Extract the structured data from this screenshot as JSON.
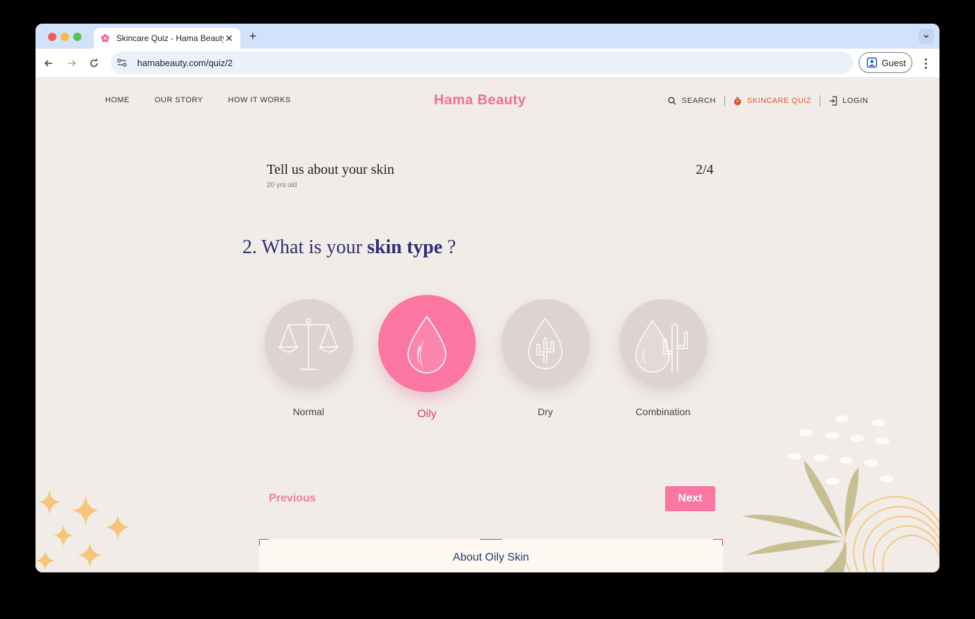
{
  "browser": {
    "tab_title": "Skincare Quiz - Hama Beauty",
    "url": "hamabeauty.com/quiz/2",
    "profile_label": "Guest"
  },
  "site": {
    "brand": "Hama Beauty",
    "nav_left": [
      "HOME",
      "OUR STORY",
      "HOW IT WORKS"
    ],
    "nav_right": {
      "search": "SEARCH",
      "quiz": "SKINCARE QUIZ",
      "login": "LOGIN"
    }
  },
  "quiz": {
    "header_title": "Tell us about your skin",
    "header_subtitle": "20 yrs old",
    "step": "2/4",
    "question_number": "2.",
    "question_prefix": "What is your",
    "question_emphasis": "skin type",
    "question_suffix": "?",
    "options": [
      {
        "label": "Normal",
        "icon": "scale-icon",
        "selected": false
      },
      {
        "label": "Oily",
        "icon": "oil-drop-icon",
        "selected": true
      },
      {
        "label": "Dry",
        "icon": "dry-drop-cactus-icon",
        "selected": false
      },
      {
        "label": "Combination",
        "icon": "drop-and-cactus-icon",
        "selected": false
      }
    ],
    "previous_label": "Previous",
    "next_label": "Next",
    "about_title": "About Oily Skin"
  },
  "colors": {
    "accent_pink": "#fb76a2",
    "brand_pink": "#ef6f99",
    "quiz_orange": "#d9572f",
    "question_navy": "#2b2f72",
    "page_bg": "#f1ece8"
  }
}
